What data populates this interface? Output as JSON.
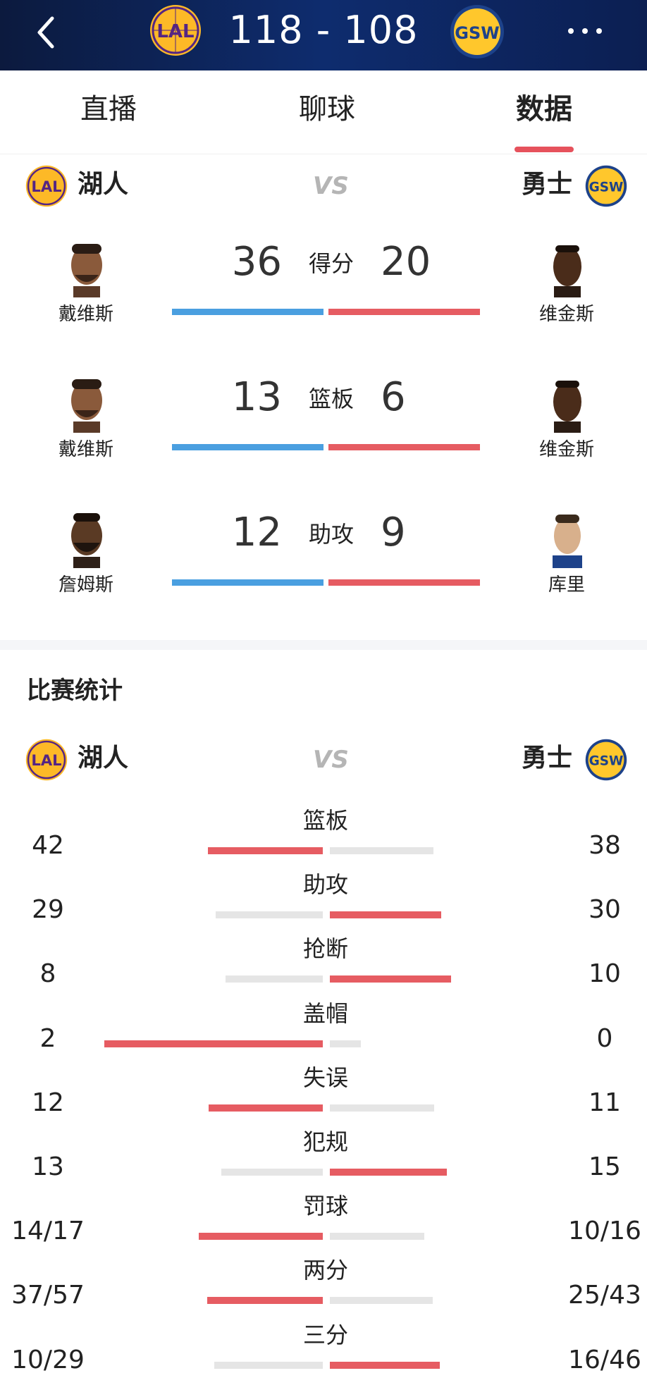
{
  "header": {
    "score": "118 - 108",
    "home_logo_text": "LAL",
    "away_logo_text": "GSW",
    "back_icon": "chevron-left-icon",
    "more_icon": "more-horizontal-icon"
  },
  "tabs": [
    {
      "label": "直播"
    },
    {
      "label": "聊球"
    },
    {
      "label": "数据",
      "active": true
    }
  ],
  "teams": {
    "home_name": "湖人",
    "away_name": "勇士",
    "vs": "VS"
  },
  "leaders": [
    {
      "category": "得分",
      "home_value": "36",
      "away_value": "20",
      "home_player": "戴维斯",
      "away_player": "维金斯"
    },
    {
      "category": "篮板",
      "home_value": "13",
      "away_value": "6",
      "home_player": "戴维斯",
      "away_player": "维金斯"
    },
    {
      "category": "助攻",
      "home_value": "12",
      "away_value": "9",
      "home_player": "詹姆斯",
      "away_player": "库里"
    }
  ],
  "game_stats": {
    "title": "比赛统计",
    "rows": [
      {
        "label": "篮板",
        "home": "42",
        "away": "38",
        "leader": "home"
      },
      {
        "label": "助攻",
        "home": "29",
        "away": "30",
        "leader": "away"
      },
      {
        "label": "抢断",
        "home": "8",
        "away": "10",
        "leader": "away"
      },
      {
        "label": "盖帽",
        "home": "2",
        "away": "0",
        "leader": "home"
      },
      {
        "label": "失误",
        "home": "12",
        "away": "11",
        "leader": "home"
      },
      {
        "label": "犯规",
        "home": "13",
        "away": "15",
        "leader": "away"
      },
      {
        "label": "罚球",
        "home": "14/17",
        "away": "10/16",
        "leader": "home"
      },
      {
        "label": "两分",
        "home": "37/57",
        "away": "25/43",
        "leader": "home"
      },
      {
        "label": "三分",
        "home": "10/29",
        "away": "16/46",
        "leader": "away"
      }
    ]
  },
  "colors": {
    "header_bg": "#0e2c6e",
    "accent_red": "#e65c62",
    "home_bar_blue": "#4a9fe0",
    "grey_bar": "#e5e5e5",
    "lakers_purple": "#552583",
    "lakers_gold": "#fdb927",
    "warriors_blue": "#1d428a",
    "warriors_gold": "#ffc72c"
  }
}
